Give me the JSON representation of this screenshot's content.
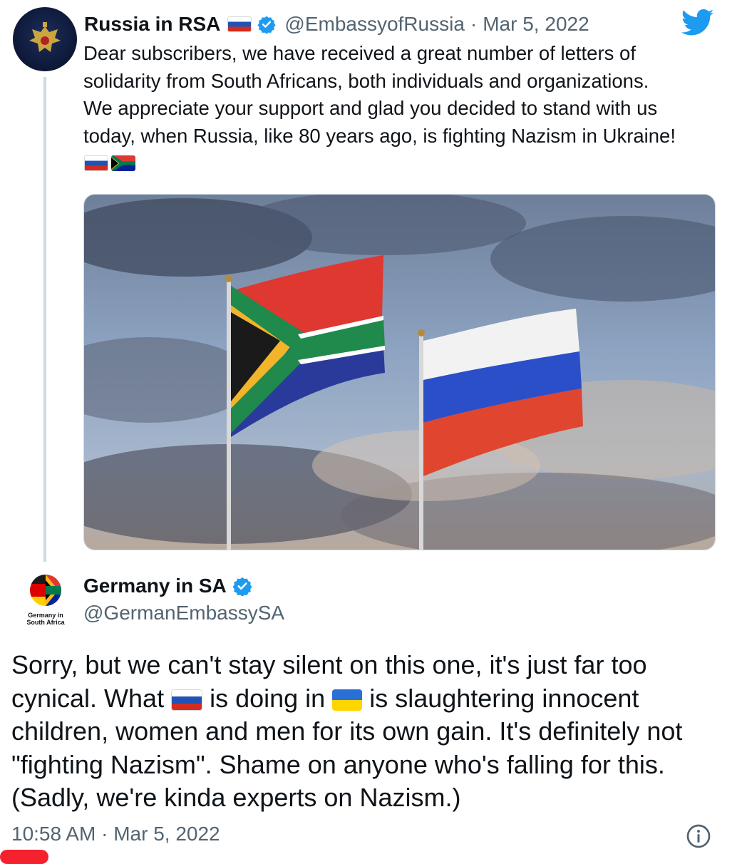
{
  "original_tweet": {
    "author_name": "Russia in RSA",
    "handle": "@EmbassyofRussia",
    "separator": "·",
    "date": "Mar 5, 2022",
    "text_lines": [
      "Dear subscribers, we have received a great number of letters of",
      "solidarity from South Africans, both individuals and organizations.",
      "We appreciate your support and glad you decided to stand with us",
      "today, when Russia, like 80 years ago, is fighting Nazism in Ukraine!"
    ],
    "flag_emojis": [
      "russia-flag",
      "south-africa-flag"
    ],
    "media": {
      "subject": "south-africa-flag-and-russia-flag-on-poles-against-cloudy-sky"
    }
  },
  "reply": {
    "author_name": "Germany in SA",
    "handle": "@GermanEmbassySA",
    "avatar_caption_line1": "Germany in",
    "avatar_caption_line2": "South Africa",
    "text_part1": "Sorry, but we can't stay silent on this one, it's just far too cynical. What ",
    "text_part2": " is doing in ",
    "text_part3": " is slaughtering innocent children, women and men for its own gain. It's definitely not \"fighting Nazism\". Shame on anyone who's falling for this. (Sadly, we're kinda experts on Nazism.)",
    "time": "10:58 AM",
    "separator": "·",
    "date": "Mar 5, 2022"
  },
  "icons": {
    "verified": "verified-badge-icon",
    "platform": "twitter-bird-icon",
    "info": "info-icon"
  },
  "colors": {
    "verified_blue": "#1d9bf0",
    "muted_text": "#536471",
    "thread_line": "#cfd9de"
  }
}
